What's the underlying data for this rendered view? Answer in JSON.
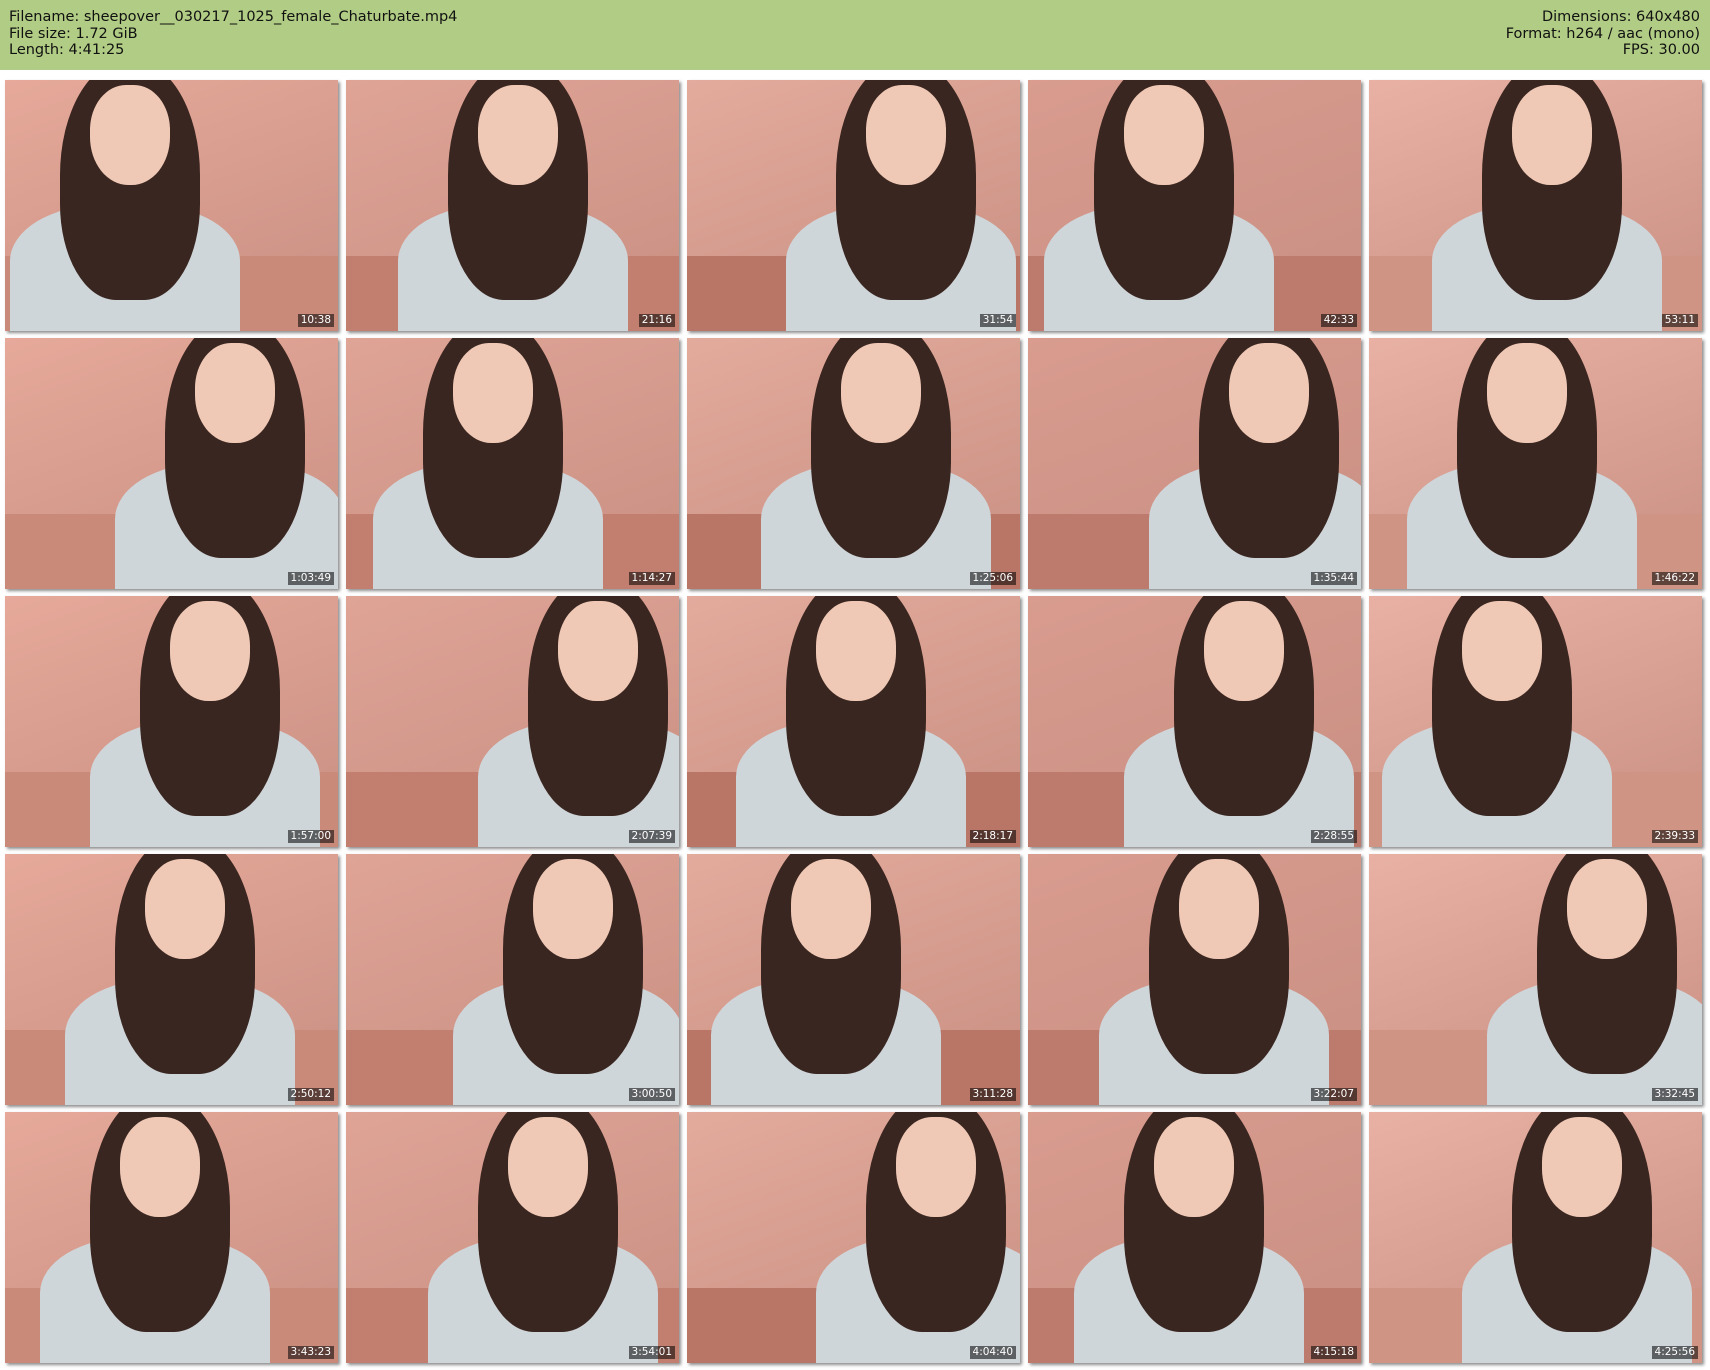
{
  "header": {
    "filename": "Filename: sheepover__030217_1025_female_Chaturbate.mp4",
    "file_size": "File size: 1.72 GiB",
    "length": "Length: 4:41:25",
    "dimensions": "Dimensions: 640x480",
    "format": "Format: h264 / aac (mono)",
    "fps": "FPS: 30.00",
    "background": "#b1cc84"
  },
  "thumbnails": [
    {
      "timestamp": "10:38"
    },
    {
      "timestamp": "21:16"
    },
    {
      "timestamp": "31:54"
    },
    {
      "timestamp": "42:33"
    },
    {
      "timestamp": "53:11"
    },
    {
      "timestamp": "1:03:49"
    },
    {
      "timestamp": "1:14:27"
    },
    {
      "timestamp": "1:25:06"
    },
    {
      "timestamp": "1:35:44"
    },
    {
      "timestamp": "1:46:22"
    },
    {
      "timestamp": "1:57:00"
    },
    {
      "timestamp": "2:07:39"
    },
    {
      "timestamp": "2:18:17"
    },
    {
      "timestamp": "2:28:55"
    },
    {
      "timestamp": "2:39:33"
    },
    {
      "timestamp": "2:50:12"
    },
    {
      "timestamp": "3:00:50"
    },
    {
      "timestamp": "3:11:28"
    },
    {
      "timestamp": "3:22:07"
    },
    {
      "timestamp": "3:32:45"
    },
    {
      "timestamp": "3:43:23"
    },
    {
      "timestamp": "3:54:01"
    },
    {
      "timestamp": "4:04:40"
    },
    {
      "timestamp": "4:15:18"
    },
    {
      "timestamp": "4:25:56"
    }
  ]
}
